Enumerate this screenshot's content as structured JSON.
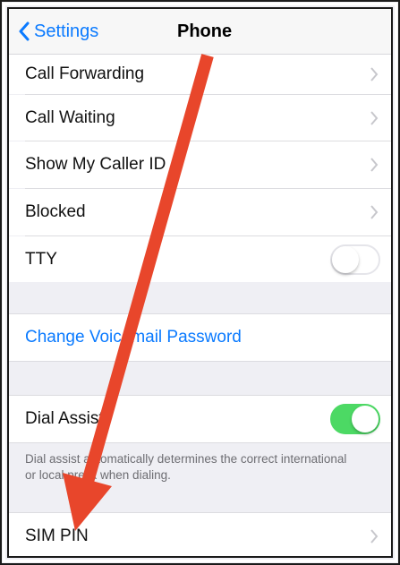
{
  "navbar": {
    "back_label": "Settings",
    "title": "Phone"
  },
  "rows": {
    "call_forwarding": "Call Forwarding",
    "call_waiting": "Call Waiting",
    "show_caller_id": "Show My Caller ID",
    "blocked": "Blocked",
    "tty": "TTY",
    "change_voicemail_password": "Change Voicemail Password",
    "dial_assist": "Dial Assist",
    "sim_pin": "SIM PIN"
  },
  "dial_assist_footnote": "Dial assist automatically determines the correct international or local prefix when dialing.",
  "toggles": {
    "tty": false,
    "dial_assist": true
  },
  "colors": {
    "accent": "#0a7aff",
    "toggle_on": "#4cd964",
    "annotation_arrow": "#e8462b"
  },
  "icons": {
    "back": "chevron-left-icon",
    "disclosure": "chevron-right-icon",
    "annotation": "red-arrow"
  }
}
